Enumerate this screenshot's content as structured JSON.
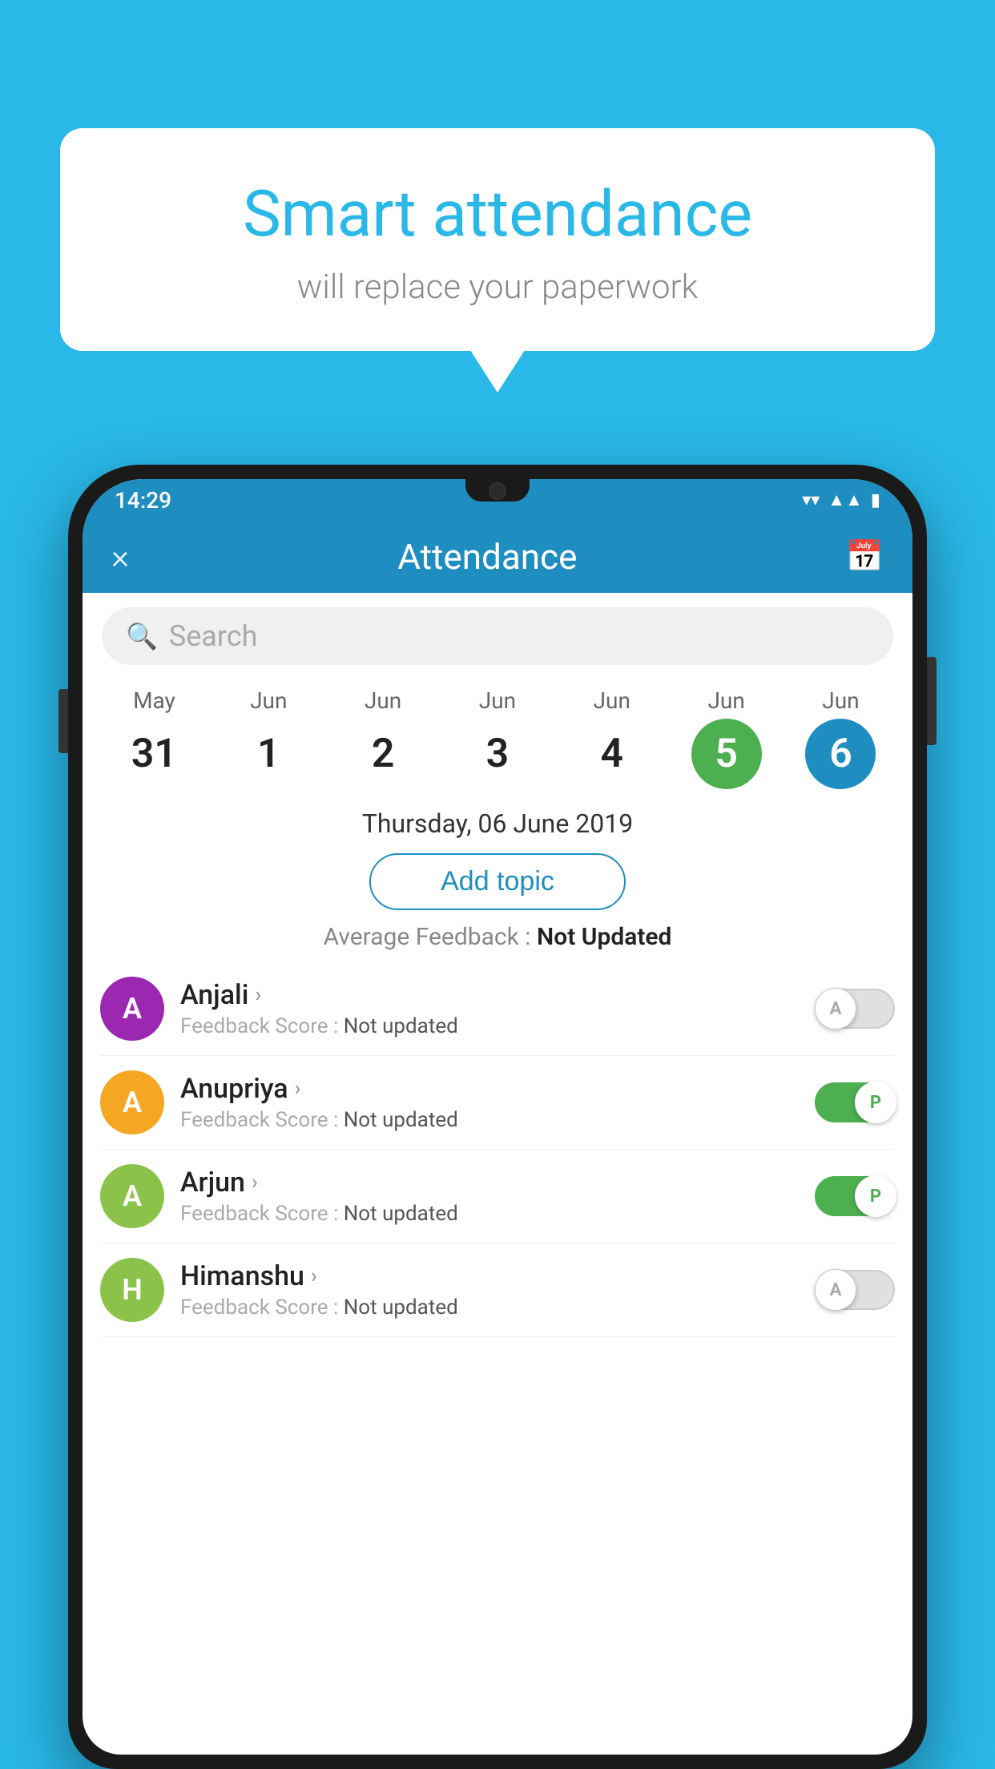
{
  "background_color": "#29b8e8",
  "bubble": {
    "title": "Smart attendance",
    "subtitle": "will replace your paperwork"
  },
  "status_bar": {
    "time": "14:29",
    "icons": [
      "wifi",
      "signal",
      "battery"
    ]
  },
  "header": {
    "title": "Attendance",
    "close_label": "×",
    "calendar_icon": "📅"
  },
  "search": {
    "placeholder": "Search"
  },
  "dates": [
    {
      "month": "May",
      "day": "31",
      "state": "normal"
    },
    {
      "month": "Jun",
      "day": "1",
      "state": "normal"
    },
    {
      "month": "Jun",
      "day": "2",
      "state": "normal"
    },
    {
      "month": "Jun",
      "day": "3",
      "state": "normal"
    },
    {
      "month": "Jun",
      "day": "4",
      "state": "normal"
    },
    {
      "month": "Jun",
      "day": "5",
      "state": "today"
    },
    {
      "month": "Jun",
      "day": "6",
      "state": "selected"
    }
  ],
  "selected_date_label": "Thursday, 06 June 2019",
  "add_topic_label": "Add topic",
  "avg_feedback_label": "Average Feedback :",
  "avg_feedback_value": "Not Updated",
  "students": [
    {
      "name": "Anjali",
      "avatar_letter": "A",
      "avatar_color": "#9c27b0",
      "score_label": "Feedback Score :",
      "score_value": "Not updated",
      "toggle_state": "off",
      "toggle_label": "A"
    },
    {
      "name": "Anupriya",
      "avatar_letter": "A",
      "avatar_color": "#f5a623",
      "score_label": "Feedback Score :",
      "score_value": "Not updated",
      "toggle_state": "on",
      "toggle_label": "P"
    },
    {
      "name": "Arjun",
      "avatar_letter": "A",
      "avatar_color": "#8bc34a",
      "score_label": "Feedback Score :",
      "score_value": "Not updated",
      "toggle_state": "on",
      "toggle_label": "P"
    },
    {
      "name": "Himanshu",
      "avatar_letter": "H",
      "avatar_color": "#8bc34a",
      "score_label": "Feedback Score :",
      "score_value": "Not updated",
      "toggle_state": "off",
      "toggle_label": "A"
    }
  ]
}
